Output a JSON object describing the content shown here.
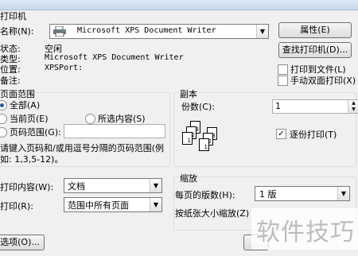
{
  "printer": {
    "section_title": "打印机",
    "name_label": "名称(N):",
    "selected_printer": "Microsoft XPS Document Writer",
    "properties_button": "属性(E)",
    "find_printer_button": "查找打印机(D)...",
    "status_label": "状态:",
    "status_value": "空闲",
    "type_label": "类型:",
    "type_value": "Microsoft XPS Document Writer",
    "where_label": "位置:",
    "where_value": "XPSPort:",
    "comment_label": "备注:",
    "print_to_file_label": "打印到文件(L)",
    "manual_duplex_label": "手动双面打印(X)"
  },
  "page_range": {
    "section_title": "页面范围",
    "all_label": "全部(A)",
    "current_page_label": "当前页(E)",
    "selection_label": "所选内容(S)",
    "pages_label": "页码范围(G):",
    "pages_value": "",
    "hint_line1": "请键入页码和/或用逗号分隔的页码范围(例",
    "hint_line2": "如: 1,3,5-12)。"
  },
  "copies": {
    "section_title": "副本",
    "count_label": "份数(C):",
    "count_value": "1",
    "collate_label": "逐份打印(T)",
    "collate_checked": true
  },
  "print_what": {
    "label": "打印内容(W):",
    "value": "文档"
  },
  "print": {
    "label": "打印(R):",
    "value": "范围中所有页面"
  },
  "zoom": {
    "section_title": "缩放",
    "pages_per_sheet_label": "每页的版数(H):",
    "pages_per_sheet_value": "1 版",
    "scale_label": "按纸张大小缩放(Z)"
  },
  "options_button": "选项(O)...",
  "watermark_text": "软件技巧"
}
